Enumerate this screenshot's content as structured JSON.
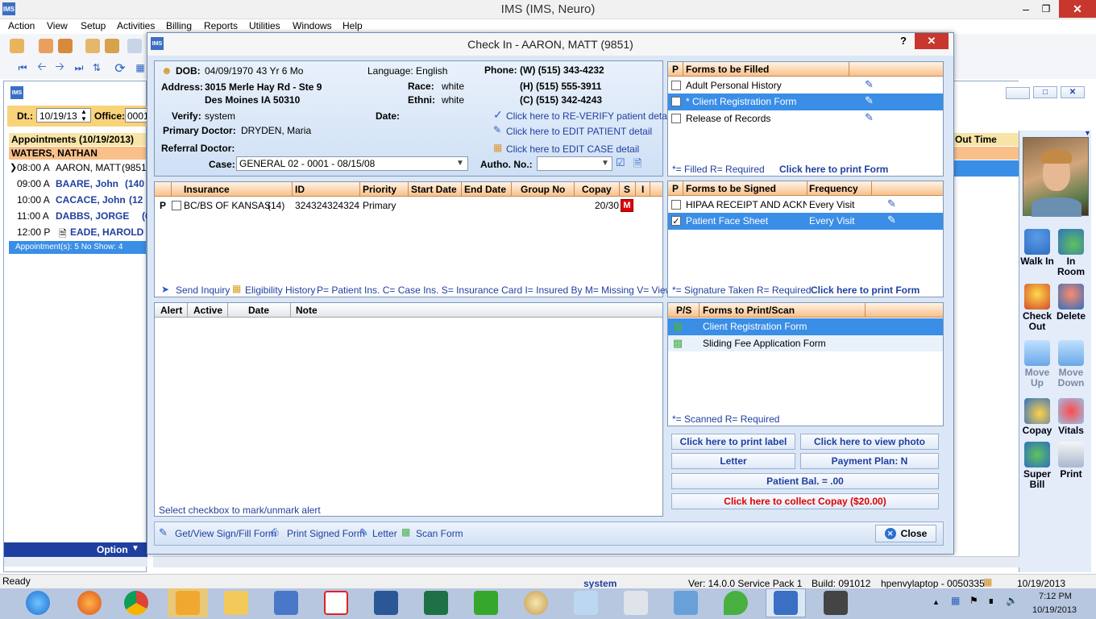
{
  "app": {
    "title": "IMS (IMS, Neuro)",
    "menu": [
      "Action",
      "View",
      "Setup",
      "Activities",
      "Billing",
      "Reports",
      "Utilities",
      "Windows",
      "Help"
    ]
  },
  "sched": {
    "dt_label": "Dt.:",
    "date": "10/19/13",
    "office_label": "Office:",
    "office": "0001",
    "list_title": "Appointments (10/19/2013)",
    "provider": "WATERS, NATHAN",
    "appts": [
      {
        "time": "08:00 A",
        "name": "AARON, MATT",
        "id": "(9851"
      },
      {
        "time": "09:00 A",
        "name": "BAARE, John",
        "id": "(140"
      },
      {
        "time": "10:00 A",
        "name": "CACACE, John",
        "id": "(12"
      },
      {
        "time": "11:00 A",
        "name": "DABBS, JORGE",
        "id": "(6"
      },
      {
        "time": "12:00 P",
        "name": "EADE, HAROLD",
        "id": ""
      }
    ],
    "summary": "Appointment(s): 5   No Show: 4",
    "option": "Option",
    "out_time": "Out Time"
  },
  "dialog": {
    "title": "Check In - AARON, MATT  (9851)",
    "help": "?"
  },
  "patient": {
    "dob_label": "DOB:",
    "dob": "04/09/1970",
    "age": "43 Yr 6 Mo",
    "language": "Language: English",
    "phone_label": "Phone:",
    "address_label": "Address:",
    "address1": "3015 Merle Hay Rd - Ste 9",
    "address2": "Des Moines  IA  50310",
    "race_label": "Race:",
    "race": "white",
    "ethni_label": "Ethni:",
    "ethni": "white",
    "phone_w": "(W)  (515) 343-4232",
    "phone_h": "(H)  (515) 555-3911",
    "phone_c": "(C)  (515) 342-4243",
    "verify_label": "Verify:",
    "verify": "system",
    "date_label": "Date:",
    "primary_label": "Primary Doctor:",
    "primary": "DRYDEN, Maria",
    "referral_label": "Referral Doctor:",
    "case_label": "Case:",
    "case": "GENERAL 02  -  0001 - 08/15/08",
    "autho_label": "Autho. No.:",
    "autho": "",
    "reverify": "Click here to RE-VERIFY patient detail",
    "edit_patient": "Click here to EDIT PATIENT detail",
    "edit_case": "Click here to EDIT CASE detail"
  },
  "insurance": {
    "headers": [
      "Insurance",
      "ID",
      "Priority",
      "Start Date",
      "End Date",
      "Group No",
      "Copay",
      "S",
      "I"
    ],
    "rows": [
      {
        "p": "P",
        "name": "BC/BS OF KANSAS",
        "num": "(14)",
        "id": "324324324324",
        "priority": "Primary",
        "start": "",
        "end": "",
        "group": "",
        "copay": "20/30",
        "s": "M"
      }
    ],
    "send_inquiry": "Send Inquiry",
    "eligibility": "Eligibility History",
    "legend": "P= Patient Ins.  C= Case Ins.  S= Insurance Card     I= Insured By    M= Missing    V= View"
  },
  "alerts": {
    "headers": [
      "Alert",
      "Active",
      "Date",
      "Note"
    ],
    "footer": "Select checkbox to mark/unmark alert"
  },
  "forms_fill": {
    "h_p": "P",
    "h_title": "Forms to be Filled",
    "items": [
      {
        "label": "Adult Personal History",
        "checked": false,
        "selected": false
      },
      {
        "label": "* Client Registration Form",
        "checked": false,
        "selected": true
      },
      {
        "label": "Release of Records",
        "checked": false,
        "selected": false
      }
    ],
    "legend": "*= Filled    R= Required",
    "print": "Click here to print Form"
  },
  "forms_sign": {
    "h_p": "P",
    "h_title": "Forms to be Signed",
    "h_freq": "Frequency",
    "items": [
      {
        "label": "HIPAA RECEIPT AND ACKNO",
        "freq": "Every Visit",
        "checked": false,
        "selected": false
      },
      {
        "label": "Patient Face Sheet",
        "freq": "Every Visit",
        "checked": true,
        "selected": true
      }
    ],
    "legend": "*= Signature Taken    R= Required",
    "print": "Click here to print Form"
  },
  "forms_scan": {
    "h_ps": "P/S",
    "h_title": "Forms to Print/Scan",
    "items": [
      {
        "label": "Client Registration Form",
        "selected": true
      },
      {
        "label": "Sliding Fee Application Form",
        "selected": false
      }
    ],
    "legend": "*= Scanned     R= Required"
  },
  "actions": {
    "print_label": "Click here to print label",
    "view_photo": "Click here to view photo",
    "letter": "Letter",
    "payment_plan": "Payment Plan: N",
    "balance": "Patient Bal. = .00",
    "collect": "Click here to collect Copay ($20.00)"
  },
  "bottom": {
    "get_view": "Get/View Sign/Fill Form",
    "print_signed": "Print Signed Form",
    "letter": "Letter",
    "scan": "Scan Form",
    "close": "Close"
  },
  "right_buttons": [
    {
      "label": "Walk In",
      "icon": "walk-in-icon"
    },
    {
      "label": "In Room",
      "icon": "in-room-icon"
    },
    {
      "label": "Check Out",
      "icon": "check-out-icon"
    },
    {
      "label": "Delete",
      "icon": "delete-icon"
    },
    {
      "label": "Move Up",
      "icon": "move-up-icon"
    },
    {
      "label": "Move Down",
      "icon": "move-down-icon"
    },
    {
      "label": "Copay",
      "icon": "copay-icon"
    },
    {
      "label": "Vitals",
      "icon": "vitals-icon"
    },
    {
      "label": "Super Bill",
      "icon": "super-bill-icon"
    },
    {
      "label": "Print",
      "icon": "print-icon"
    }
  ],
  "status": {
    "ready": "Ready",
    "user": "system",
    "version": "Ver: 14.0.0 Service Pack 1",
    "build": "Build: 091012",
    "machine": "hpenvylaptop - 0050335",
    "date": "10/19/2013"
  },
  "clock": {
    "time": "7:12 PM",
    "date": "10/19/2013"
  },
  "colors": {
    "accent": "#1f3fa0",
    "selected": "#3a8ee6",
    "header_orange": "#f9c08a",
    "red": "#e00000",
    "panel_bg": "#dbe7f6"
  }
}
